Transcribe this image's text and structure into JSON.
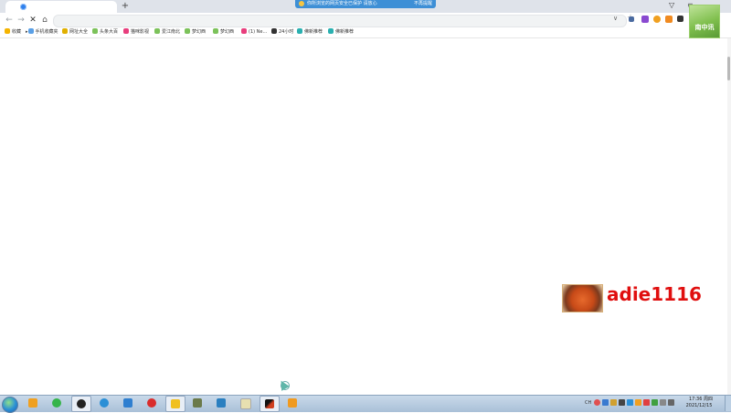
{
  "browser": {
    "notification": {
      "message": "你所浏览的网页安全已保护 请放心",
      "dismiss_label": "不再提醒"
    },
    "address": {
      "value": "",
      "placeholder": ""
    }
  },
  "bookmarks": [
    {
      "label": "收藏",
      "color": "#f5b400"
    },
    {
      "label": "手机收藏夹",
      "color": "#5aa0e6"
    },
    {
      "label": "网址大全",
      "color": "#e1b000"
    },
    {
      "label": "头条大百",
      "color": "#7cc25a"
    },
    {
      "label": "猫咪影视",
      "color": "#e83e7d"
    },
    {
      "label": "爱江南北",
      "color": "#7cc25a"
    },
    {
      "label": "梦幻西",
      "color": "#7cc25a"
    },
    {
      "label": "梦幻西",
      "color": "#7cc25a"
    },
    {
      "label": "(1) Ne...",
      "color": "#e83e7d"
    },
    {
      "label": "24小时",
      "color": "#333333"
    },
    {
      "label": "佛新推荐",
      "color": "#2ab0b0"
    },
    {
      "label": "佛新推荐",
      "color": "#2ab0b0"
    }
  ],
  "avatar": {
    "label": "南中讯"
  },
  "watermark": {
    "text": "adie1116"
  },
  "taskbar": {
    "apps": [
      {
        "name": "folder-app",
        "color": "#f0a020",
        "active": false
      },
      {
        "name": "green-app",
        "color": "#35b44a",
        "active": false
      },
      {
        "name": "obs-app",
        "color": "#222222",
        "active": true
      },
      {
        "name": "cloud-app",
        "color": "#2a8fd6",
        "active": false
      },
      {
        "name": "bird-app",
        "color": "#2f7fd0",
        "active": false
      },
      {
        "name": "netease-app",
        "color": "#d92c2c",
        "active": false
      },
      {
        "name": "face-app",
        "color": "#f0c020",
        "active": true
      },
      {
        "name": "game-app",
        "color": "#6b7a4a",
        "active": false
      },
      {
        "name": "network-app",
        "color": "#2a7fc0",
        "active": false
      },
      {
        "name": "notes-app",
        "color": "#e8e0b0",
        "active": false
      },
      {
        "name": "video-app",
        "color": "#d04020",
        "active": true
      },
      {
        "name": "help-app",
        "color": "#f09a20",
        "active": false
      }
    ],
    "tray_lang": "CH",
    "clock_time": "17:36 周四",
    "clock_date": "2021/12/15"
  }
}
